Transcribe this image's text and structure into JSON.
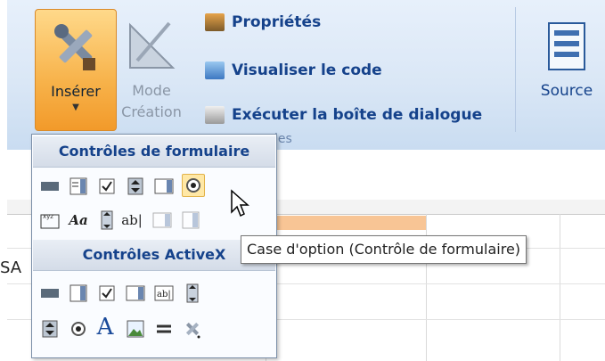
{
  "ribbon": {
    "insert_label": "Insérer",
    "mode_label_1": "Mode",
    "mode_label_2": "Création",
    "commands": [
      "Propriétés",
      "Visualiser le code",
      "Exécuter la boîte de dialogue"
    ],
    "source_label": "Source",
    "group_label": "les"
  },
  "dropdown": {
    "form_controls_heading": "Contrôles de formulaire",
    "activex_heading": "Contrôles ActiveX",
    "form_row1": [
      "button-icon",
      "combo-box-icon",
      "checkbox-icon",
      "spin-button-icon",
      "list-box-icon",
      "option-button-icon"
    ],
    "form_row2": [
      "group-box-icon",
      "label-icon",
      "scroll-bar-icon",
      "text-field-icon",
      "combo-list-icon",
      "combo-dropdown-icon"
    ],
    "activex_row1": [
      "button-icon",
      "combo-box-icon",
      "checkbox-icon",
      "list-box-icon",
      "text-box-icon",
      "scroll-bar-icon"
    ],
    "activex_row2": [
      "spin-button-icon",
      "option-button-icon",
      "label-icon",
      "image-icon",
      "toggle-icon",
      "more-controls-icon"
    ],
    "glyphs": {
      "label": "Aa",
      "text_field": "ab|",
      "label_activex": "A"
    }
  },
  "tooltip": "Case d'option (Contrôle de formulaire)",
  "sheet": {
    "row_label": "SA"
  },
  "colors": {
    "accent": "#15428b",
    "highlight": "#ffe8a6",
    "insert_button": "#f7b24a"
  }
}
